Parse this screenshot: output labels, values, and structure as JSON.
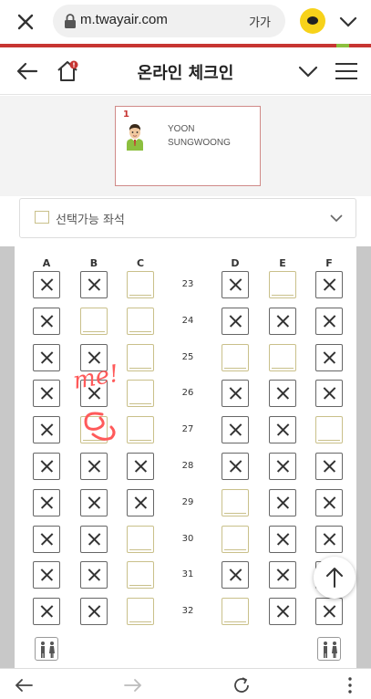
{
  "browser": {
    "url": "m.twayair.com",
    "font_size_label": "가가"
  },
  "header": {
    "title": "온라인 체크인"
  },
  "passenger": {
    "number": "1",
    "first_name": "YOON",
    "last_name": "SUNGWOONG"
  },
  "seat_filter": {
    "label": "선택가능 좌석"
  },
  "seat_map": {
    "columns_left": [
      "A",
      "B",
      "C"
    ],
    "columns_right": [
      "D",
      "E",
      "F"
    ],
    "rows": [
      {
        "num": "23",
        "seats": [
          "occ",
          "occ",
          "avl",
          "occ",
          "avl",
          "occ"
        ]
      },
      {
        "num": "24",
        "seats": [
          "occ",
          "avl",
          "avl",
          "occ",
          "occ",
          "occ"
        ]
      },
      {
        "num": "25",
        "seats": [
          "occ",
          "occ",
          "avl",
          "avl",
          "avl",
          "occ"
        ]
      },
      {
        "num": "26",
        "seats": [
          "occ",
          "occ",
          "avl",
          "occ",
          "occ",
          "occ"
        ]
      },
      {
        "num": "27",
        "seats": [
          "occ",
          "avl",
          "avl",
          "occ",
          "occ",
          "avl"
        ]
      },
      {
        "num": "28",
        "seats": [
          "occ",
          "occ",
          "occ",
          "occ",
          "occ",
          "occ"
        ]
      },
      {
        "num": "29",
        "seats": [
          "occ",
          "occ",
          "occ",
          "avl",
          "occ",
          "occ"
        ]
      },
      {
        "num": "30",
        "seats": [
          "occ",
          "occ",
          "avl",
          "avl",
          "occ",
          "occ"
        ]
      },
      {
        "num": "31",
        "seats": [
          "occ",
          "occ",
          "avl",
          "occ",
          "occ",
          "occ"
        ]
      },
      {
        "num": "32",
        "seats": [
          "occ",
          "occ",
          "avl",
          "avl",
          "occ",
          "occ"
        ]
      }
    ]
  },
  "annotation": {
    "text": "me!",
    "color": "#ff5a5a"
  },
  "colors": {
    "brand_red": "#c73532",
    "available_seat": "#c9c08a"
  }
}
